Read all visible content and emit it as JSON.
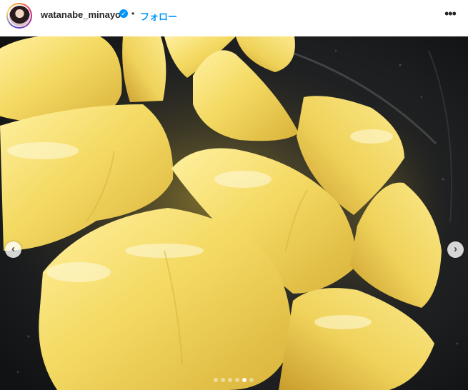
{
  "post_header": {
    "username": "watanabe_minayo",
    "verified_icon": "verified-badge-icon",
    "separator": "•",
    "follow_label": "フォロー",
    "more_icon": "more-options-icon",
    "more_glyph": "•••"
  },
  "carousel": {
    "prev_glyph": "‹",
    "next_glyph": "›",
    "slide_count": 6,
    "active_index": 4
  },
  "colors": {
    "accent": "#0095f6",
    "potato": "#f2d860",
    "pan": "#1c1d1e"
  }
}
